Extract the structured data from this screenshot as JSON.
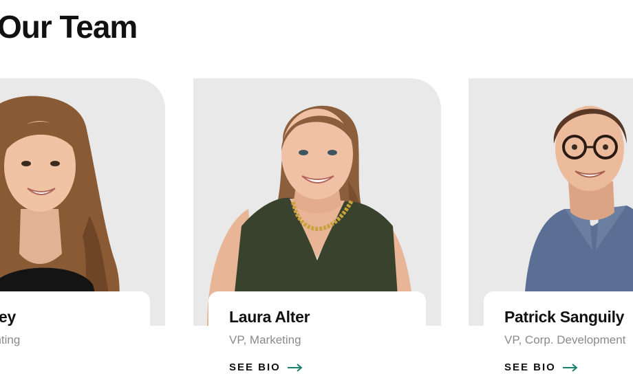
{
  "section": {
    "title": "Our Team"
  },
  "team": [
    {
      "name": "a Spivey",
      "role": "r, Accounting",
      "bio_label": "",
      "arrow_icon": "arrow-right-icon"
    },
    {
      "name": "Laura Alter",
      "role": "VP, Marketing",
      "bio_label": "SEE BIO",
      "arrow_icon": "arrow-right-icon"
    },
    {
      "name": "Patrick Sanguily",
      "role": "VP, Corp. Development",
      "bio_label": "SEE BIO",
      "arrow_icon": "arrow-right-icon"
    }
  ],
  "colors": {
    "accent": "#17806b",
    "photo_bg": "#e9e9e9",
    "text": "#111111",
    "muted": "#8a8a8a"
  }
}
